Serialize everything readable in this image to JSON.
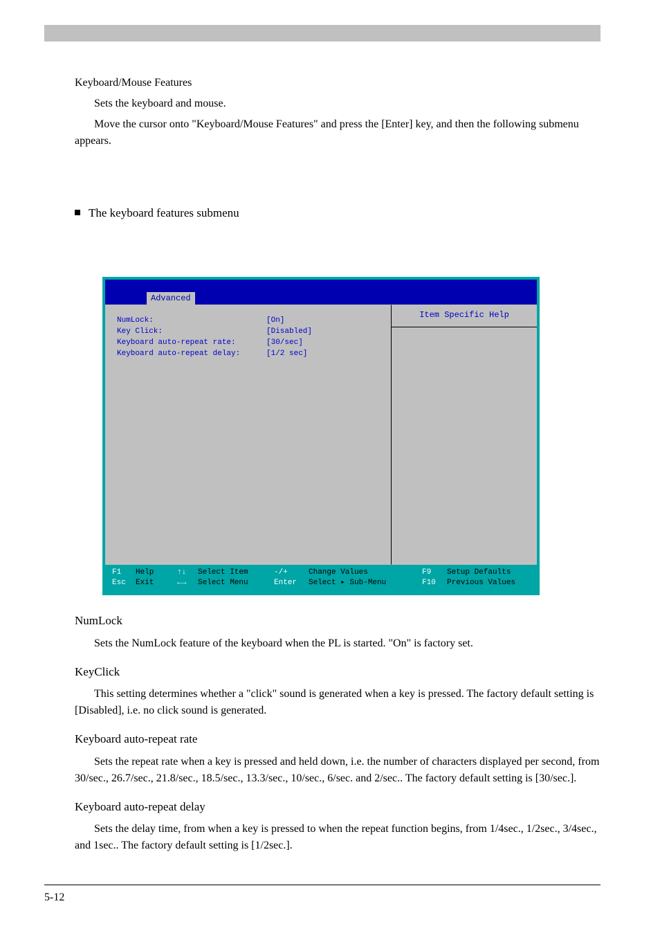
{
  "pre": {
    "l1": "Keyboard/Mouse Features",
    "l2": "Sets the keyboard and mouse.",
    "l3": "Move the cursor onto \"Keyboard/Mouse Features\" and press the [Enter] key, and then the following submenu appears."
  },
  "submenu": {
    "label": "The keyboard features submenu"
  },
  "bios": {
    "tab": "Advanced",
    "rows": [
      {
        "label": "NumLock:",
        "value": "[On]"
      },
      {
        "label": "Key Click:",
        "value": "[Disabled]"
      },
      {
        "label": "Keyboard auto-repeat rate:",
        "value": "[30/sec]"
      },
      {
        "label": "Keyboard auto-repeat delay:",
        "value": "[1/2 sec]"
      }
    ],
    "help_title": "Item Specific Help",
    "footer": {
      "r1": {
        "k1": "F1",
        "l1": "Help",
        "k2": "↑↓",
        "l2": "Select Item",
        "k3": "-/+",
        "l3": "Change Values",
        "k4": "F9",
        "l4": "Setup Defaults"
      },
      "r2": {
        "k1": "Esc",
        "l1": "Exit",
        "k2": "←→",
        "l2": "Select Menu",
        "k3": "Enter",
        "l3": "Select ▸ Sub-Menu",
        "k4": "F10",
        "l4": "Previous Values"
      }
    }
  },
  "body": {
    "h1": "NumLock",
    "p1": "Sets the NumLock feature of the keyboard when the PL is started. \"On\" is factory set.",
    "h2": "KeyClick",
    "p2": "This setting determines whether a \"click\" sound is generated when a key is pressed. The factory default setting is [Disabled], i.e. no click sound is generated.",
    "h3": "Keyboard auto-repeat rate",
    "p3": "Sets the repeat rate when a key is pressed and held down, i.e. the number of characters displayed per second, from 30/sec., 26.7/sec., 21.8/sec., 18.5/sec., 13.3/sec., 10/sec., 6/sec. and 2/sec.. The factory default setting is [30/sec.].",
    "h4": "Keyboard auto-repeat delay",
    "p4": "Sets the delay time, from when a key is pressed to when the repeat function begins, from 1/4sec., 1/2sec., 3/4sec., and 1sec.. The factory default setting is [1/2sec.]."
  },
  "page_num": "5-12"
}
